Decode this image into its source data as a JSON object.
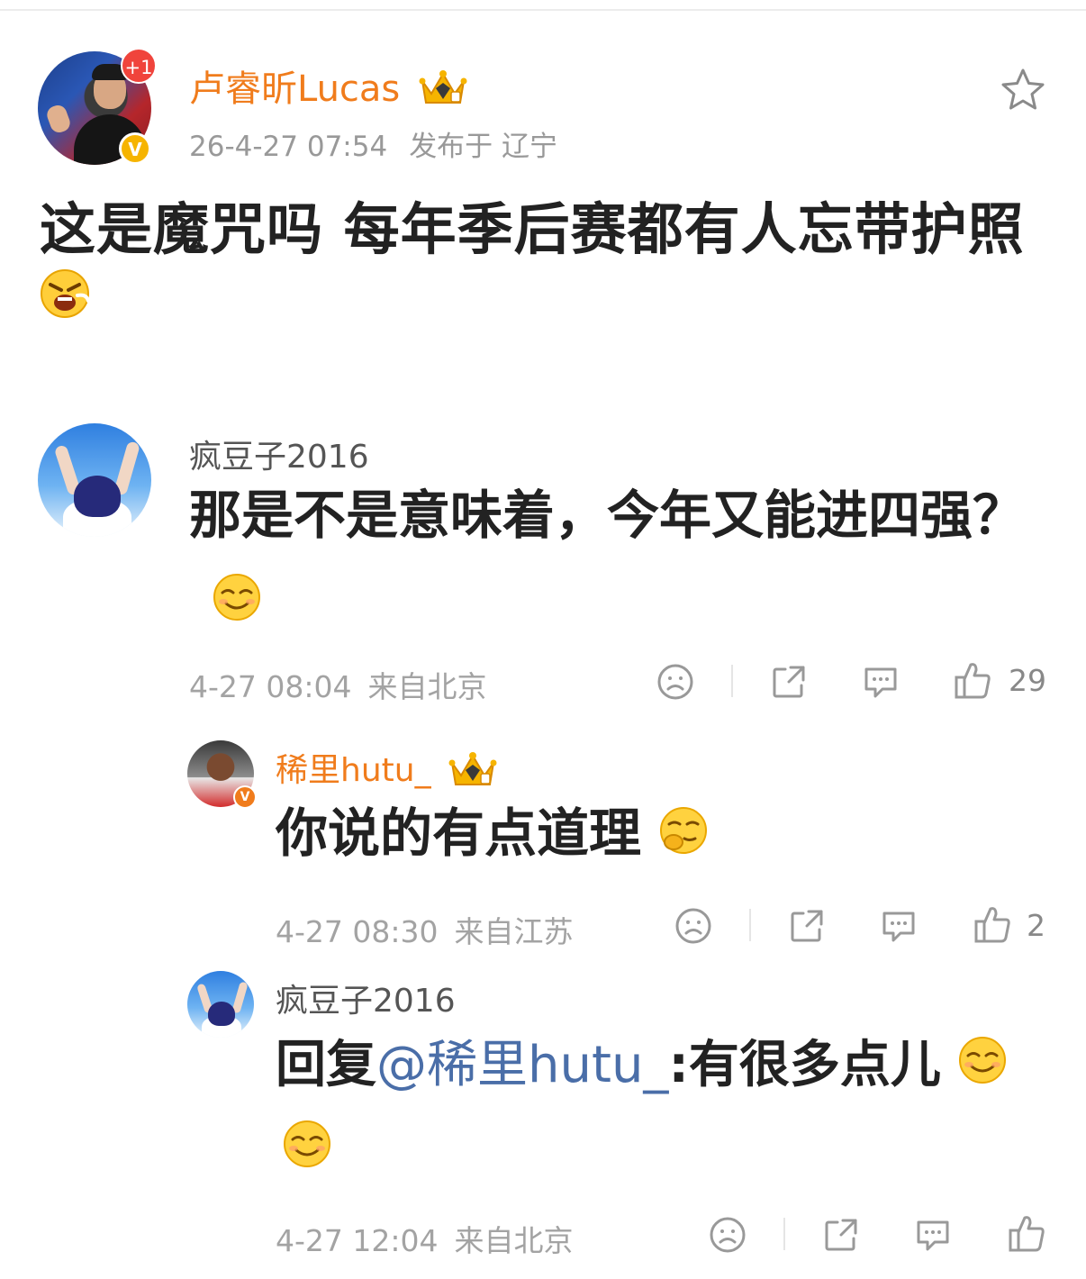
{
  "post": {
    "author": "卢睿昕Lucas",
    "notification_badge": "+1",
    "verified_badge": "V",
    "time": "26-4-27 07:54",
    "location": "发布于 辽宁",
    "text": "这是魔咒吗 每年季后赛都有人忘带护照",
    "emoji": "angry-face-icon"
  },
  "comments": [
    {
      "author": "疯豆子2016",
      "text": "那是不是意味着，今年又能进四强？",
      "emoji": "smirk-face-icon",
      "time": "4-27 08:04",
      "location": "来自北京",
      "likes": "29"
    }
  ],
  "replies": [
    {
      "author": "稀里hutu_",
      "text": "你说的有点道理",
      "emoji": "thinking-face-icon",
      "time": "4-27 08:30",
      "location": "来自江苏",
      "likes": "2"
    },
    {
      "author": "疯豆子2016",
      "reply_prefix": "回复",
      "mention": "@稀里hutu_",
      "text": ":有很多点儿",
      "time": "4-27 12:04",
      "location": "来自北京"
    }
  ],
  "colors": {
    "username_vip": "#f07c1c",
    "mention": "#4a6ea8",
    "meta": "#a3a3a3",
    "badge_red": "#f0443c",
    "badge_gold": "#f6b400"
  }
}
